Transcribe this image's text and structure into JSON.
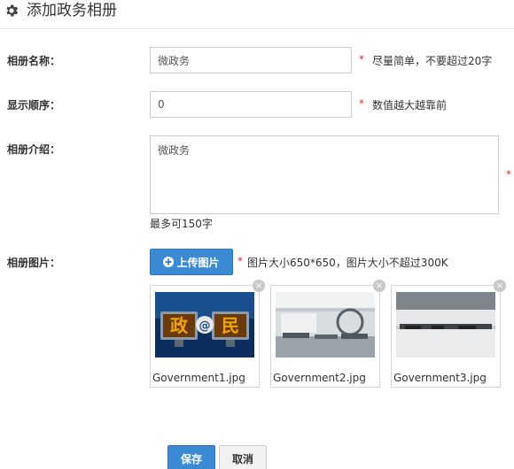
{
  "header": {
    "title": "添加政务相册",
    "icon": "gear-icon"
  },
  "form": {
    "name": {
      "label": "相册名称：",
      "value": "微政务",
      "required_mark": "*",
      "hint": "尽量简单，不要超过20字"
    },
    "order": {
      "label": "显示顺序：",
      "value": "0",
      "required_mark": "*",
      "hint": "数值越大越靠前"
    },
    "intro": {
      "label": "相册介绍：",
      "value": "微政务",
      "required_mark": "*",
      "limit_hint": "最多可150字"
    },
    "images": {
      "label": "相册图片：",
      "upload_label": "上传图片",
      "required_mark": "*",
      "hint": "图片大小650*650，图片大小不超过300K",
      "files": [
        {
          "name": "Government1.jpg"
        },
        {
          "name": "Government2.jpg"
        },
        {
          "name": "Government3.jpg"
        }
      ],
      "image1_text": {
        "left": "政",
        "mid": "@",
        "right": "民"
      }
    }
  },
  "actions": {
    "save_label": "保存",
    "cancel_label": "取消"
  },
  "colors": {
    "primary": "#3a8ad6",
    "required": "#d9302f",
    "border": "#cccccc"
  }
}
